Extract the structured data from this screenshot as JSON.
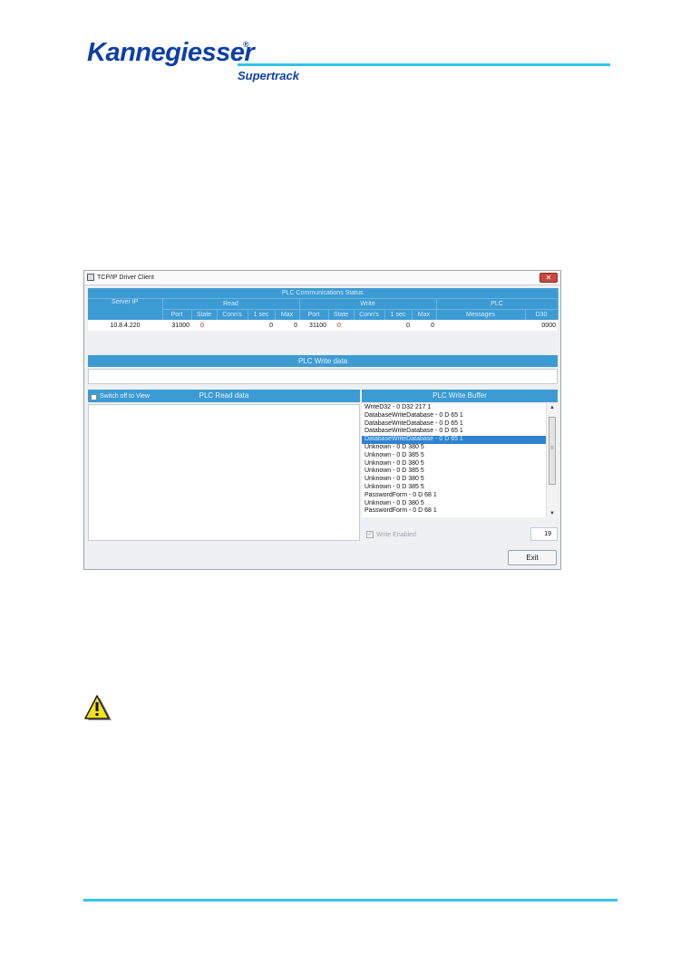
{
  "logo": {
    "name": "Kannegiesser",
    "registered": "®",
    "product": "Supertrack"
  },
  "window": {
    "title": "TCP/IP Driver Client",
    "close_glyph": "✕",
    "status_header": "PLC Communications Status",
    "columns": {
      "server_ip": "Server IP",
      "read": "Read",
      "write": "Write",
      "plc": "PLC",
      "port": "Port",
      "state": "State",
      "conns": "Conn's",
      "one_sec": "1 sec",
      "max": "Max",
      "messages": "Messages",
      "d30": "D30"
    },
    "row": {
      "server_ip": "10.8.4.220",
      "read_port": "31000",
      "read_state": "0",
      "read_conns": "",
      "read_1sec": "0",
      "read_max": "0",
      "write_port": "31100",
      "write_state": "0",
      "write_conns": "",
      "write_1sec": "0",
      "write_max": "0",
      "messages": "",
      "d30": "0000"
    },
    "write_data_header": "PLC Write data",
    "switch_label": "Switch off to View",
    "read_data_header": "PLC Read data",
    "write_buffer_header": "PLC Write Buffer",
    "buffer": [
      "WriteD32  - 0 D32 217 1",
      "DatabaseWriteDatabase - 0 D 65 1",
      "DatabaseWriteDatabase - 0 D 65 1",
      "DatabaseWriteDatabase - 0 D 65 1",
      "DatabaseWriteDatabase - 0 D 65 1",
      "Unknown - 0 D 380 5",
      "Unknown - 0 D 385 5",
      "Unknown - 0 D 380 5",
      "Unknown - 0 D 385 5",
      "Unknown - 0 D 380 5",
      "Unknown - 0 D 385 5",
      "PasswordForm - 0 D 68 1",
      "Unknown - 0 D 380 5",
      "PasswordForm - 0 D 68 1"
    ],
    "selected_index": 4,
    "write_enabled_label": "Write Enabled",
    "write_enabled_checked": true,
    "count": "19",
    "exit_label": "Exit"
  },
  "colors": {
    "brand": "#0d3fa6",
    "rule": "#33c4e8",
    "header_blue": "#3d9bd4",
    "selection": "#2f82d0"
  }
}
